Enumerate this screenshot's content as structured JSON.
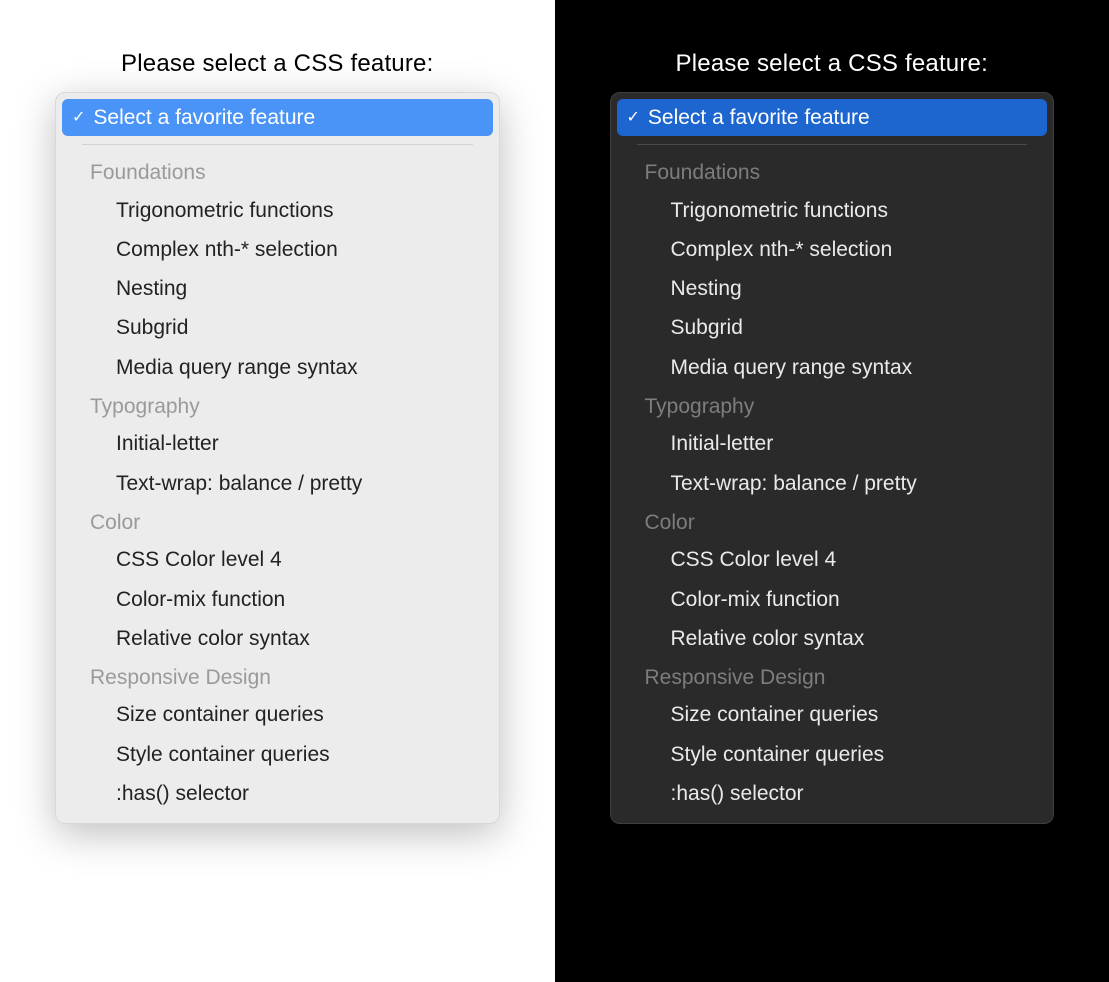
{
  "prompt_text": "Please select a CSS feature:",
  "selected_label": "Select a favorite feature",
  "colors": {
    "light_accent": "#4a94f8",
    "dark_accent": "#1d66d0"
  },
  "groups": [
    {
      "label": "Foundations",
      "options": [
        "Trigonometric functions",
        "Complex nth-* selection",
        "Nesting",
        "Subgrid",
        "Media query range syntax"
      ]
    },
    {
      "label": "Typography",
      "options": [
        "Initial-letter",
        "Text-wrap: balance / pretty"
      ]
    },
    {
      "label": "Color",
      "options": [
        "CSS Color level 4",
        "Color-mix function",
        "Relative color syntax"
      ]
    },
    {
      "label": "Responsive Design",
      "options": [
        "Size container queries",
        "Style container queries",
        ":has() selector"
      ]
    }
  ]
}
